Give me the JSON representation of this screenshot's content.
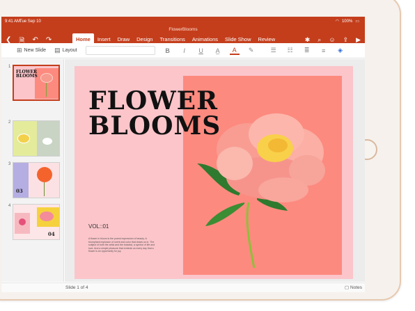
{
  "status": {
    "time": "9:41 AM",
    "date": "Tue Sep 10",
    "battery": "100%"
  },
  "document": {
    "title": "FlowerBlooms"
  },
  "tabs": [
    "Home",
    "Insert",
    "Draw",
    "Design",
    "Transitions",
    "Animations",
    "Slide Show",
    "Review"
  ],
  "toolbar": {
    "new_slide": "New Slide",
    "layout": "Layout",
    "bold": "B",
    "italic": "I",
    "underline": "U"
  },
  "thumbnails": [
    {
      "number": "1",
      "title": "FLOWER BLOOMS"
    },
    {
      "number": "2",
      "label": ""
    },
    {
      "number": "3",
      "label": "03"
    },
    {
      "number": "4",
      "label": "04"
    }
  ],
  "slide": {
    "title_line1": "FLOWER",
    "title_line2": "BLOOMS",
    "vol": "VOL::01",
    "body": "A flower in bloom is the purest expression of beauty. A triumphant explosion of scent and color that draws us in. The subject of both the artist and the botanist, a symbol of life and love. And a simple pleasure that reminds us every day that a flower is an opportunity for joy."
  },
  "footer": {
    "slide_count": "Slide 1 of 4",
    "notes": "Notes"
  },
  "colors": {
    "accent": "#c43e1c",
    "slide_bg": "#fbc5ca",
    "slide_panel": "#fd8a7f"
  }
}
